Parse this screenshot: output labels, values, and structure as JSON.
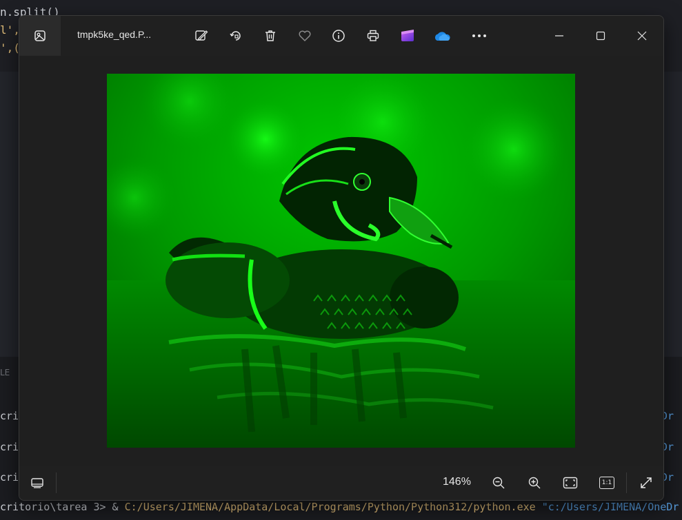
{
  "background": {
    "code_lines": [
      {
        "text": "n.split()",
        "color": "#cfd2d8"
      },
      {
        "text": "l',",
        "color": "#e5c07b"
      },
      {
        "text": "',(",
        "color": "#e5c07b"
      }
    ],
    "panel_tab": "LE",
    "terminal_left": [
      "crito",
      "crito",
      "crito"
    ],
    "terminal_right": [
      "eDr",
      "eDr",
      "eDr"
    ],
    "terminal_prompt": "critorio\\tarea 3> & ",
    "terminal_cmd": "C:/Users/JIMENA/AppData/Local/Programs/Python/Python312/python.exe",
    "terminal_arg": "\"c:/Users/JIMENA/OneDr"
  },
  "viewer": {
    "title": "tmpk5ke_qed.P...",
    "toolbar": {
      "edit_icon": "edit-image-icon",
      "rotate_icon": "rotate-icon",
      "delete_icon": "trash-icon",
      "favorite_icon": "heart-icon",
      "info_icon": "info-icon",
      "print_icon": "printer-icon",
      "clipchamp_icon": "clipchamp-icon",
      "onedrive_icon": "onedrive-icon",
      "more_icon": "more-icon"
    },
    "window_controls": [
      "minimize",
      "maximize",
      "close"
    ],
    "zoom": "146%",
    "bottom": {
      "filmstrip_icon": "filmstrip-icon",
      "zoom_out_icon": "zoom-out-icon",
      "zoom_in_icon": "zoom-in-icon",
      "fit_icon": "fit-to-window-icon",
      "actual_size_label": "1:1",
      "fullscreen_icon": "fullscreen-icon"
    },
    "colors": {
      "accent_green": "#00ff00",
      "window_bg": "#202020"
    }
  }
}
